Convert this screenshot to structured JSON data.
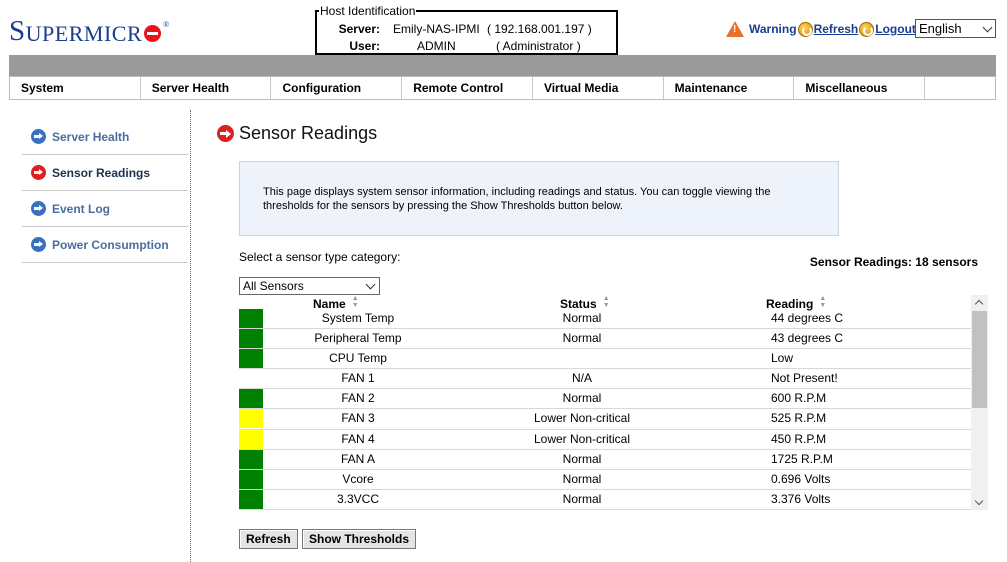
{
  "brand": {
    "logo_first": "S",
    "logo_rest": "UPERMICR",
    "reg": "®"
  },
  "host": {
    "legend": "Host Identification",
    "server_label": "Server:",
    "server_name": "Emily-NAS-IPMI",
    "server_ip": "( 192.168.001.197 )",
    "user_label": "User:",
    "user_name": "ADMIN",
    "user_role": "( Administrator )"
  },
  "top_links": {
    "warning": "Warning",
    "refresh": "Refresh",
    "logout": "Logout"
  },
  "language": {
    "selected": "English"
  },
  "menu": [
    {
      "label": "System"
    },
    {
      "label": "Server Health"
    },
    {
      "label": "Configuration"
    },
    {
      "label": "Remote Control"
    },
    {
      "label": "Virtual Media"
    },
    {
      "label": "Maintenance"
    },
    {
      "label": "Miscellaneous"
    }
  ],
  "sidebar": [
    {
      "label": "Server Health"
    },
    {
      "label": "Sensor Readings"
    },
    {
      "label": "Event Log"
    },
    {
      "label": "Power Consumption"
    }
  ],
  "page": {
    "title": "Sensor Readings",
    "info": "This page displays system sensor information, including readings and status. You can toggle viewing the thresholds for the sensors by pressing the Show Thresholds button below.",
    "select_label": "Select a sensor type category:",
    "sensor_count": "Sensor Readings: 18 sensors",
    "category_selected": "All Sensors"
  },
  "table": {
    "headers": {
      "name": "Name",
      "status": "Status",
      "reading": "Reading"
    },
    "rows": [
      {
        "name": "System Temp",
        "status": "Normal",
        "reading": "44 degrees C",
        "color": "#008000"
      },
      {
        "name": "Peripheral Temp",
        "status": "Normal",
        "reading": "43 degrees C",
        "color": "#008000"
      },
      {
        "name": "CPU Temp",
        "status": "",
        "reading": "Low",
        "color": "#008000"
      },
      {
        "name": "FAN 1",
        "status": "N/A",
        "reading": "Not Present!",
        "color": ""
      },
      {
        "name": "FAN 2",
        "status": "Normal",
        "reading": "600 R.P.M",
        "color": "#008000"
      },
      {
        "name": "FAN 3",
        "status": "Lower Non-critical",
        "reading": "525 R.P.M",
        "color": "#ffff00"
      },
      {
        "name": "FAN 4",
        "status": "Lower Non-critical",
        "reading": "450 R.P.M",
        "color": "#ffff00"
      },
      {
        "name": "FAN A",
        "status": "Normal",
        "reading": "1725 R.P.M",
        "color": "#008000"
      },
      {
        "name": "Vcore",
        "status": "Normal",
        "reading": "0.696 Volts",
        "color": "#008000"
      },
      {
        "name": "3.3VCC",
        "status": "Normal",
        "reading": "3.376 Volts",
        "color": "#008000"
      }
    ]
  },
  "buttons": {
    "refresh": "Refresh",
    "thresholds": "Show Thresholds"
  }
}
